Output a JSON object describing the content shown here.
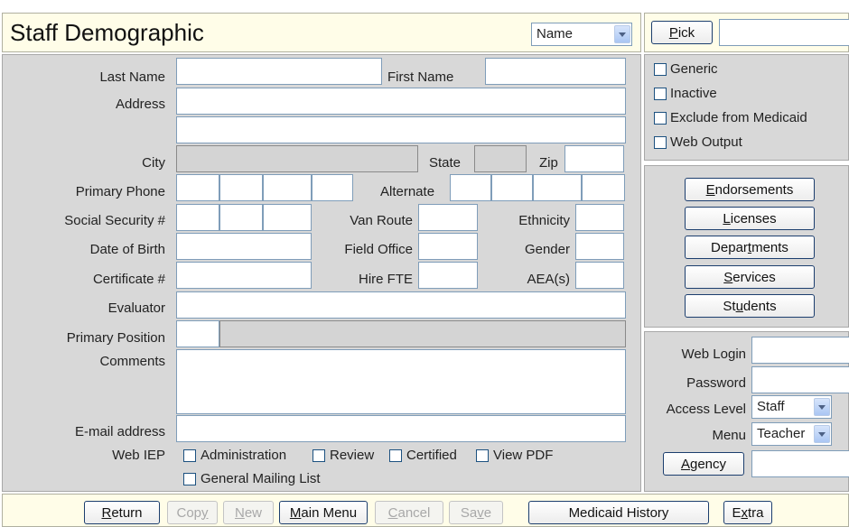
{
  "header": {
    "title": "Staff Demographic",
    "sort_select": "Name"
  },
  "pick": {
    "button_label": "Pick",
    "button_key": "P",
    "button_rest": "ick",
    "value": ""
  },
  "form": {
    "last_name_label": "Last Name",
    "first_name_label": "First Name",
    "address_label": "Address",
    "city_label": "City",
    "state_label": "State",
    "zip_label": "Zip",
    "primary_phone_label": "Primary Phone",
    "alternate_label": "Alternate",
    "ssn_label": "Social Security #",
    "van_route_label": "Van Route",
    "ethnicity_label": "Ethnicity",
    "dob_label": "Date of Birth",
    "field_office_label": "Field Office",
    "gender_label": "Gender",
    "certificate_label": "Certificate #",
    "hire_fte_label": "Hire FTE",
    "aea_label": "AEA(s)",
    "evaluator_label": "Evaluator",
    "primary_position_label": "Primary Position",
    "comments_label": "Comments",
    "email_label": "E-mail address",
    "web_iep_label": "Web IEP",
    "web_iep_options": [
      "Administration",
      "Review",
      "Certified",
      "View PDF"
    ],
    "general_mailing_label": "General Mailing List"
  },
  "flags": [
    "Generic",
    "Inactive",
    "Exclude from Medicaid",
    "Web Output"
  ],
  "side_buttons": [
    {
      "pre": "",
      "key": "E",
      "post": "ndorsements"
    },
    {
      "pre": "",
      "key": "L",
      "post": "icenses"
    },
    {
      "pre": "Depar",
      "key": "t",
      "post": "ments"
    },
    {
      "pre": "",
      "key": "S",
      "post": "ervices"
    },
    {
      "pre": "St",
      "key": "u",
      "post": "dents"
    }
  ],
  "web": {
    "login_label": "Web Login",
    "password_label": "Password",
    "access_level_label": "Access Level",
    "access_level_value": "Staff",
    "menu_label": "Menu",
    "menu_value": "Teacher",
    "agency_button": "Agency",
    "agency_key": "A",
    "agency_rest": "gency"
  },
  "footer": {
    "return_key": "R",
    "return_rest": "eturn",
    "copy_pre": "Cop",
    "copy_key": "y",
    "copy_post": "",
    "new_key": "N",
    "new_rest": "ew",
    "main_menu_key": "M",
    "main_menu_rest": "ain Menu",
    "cancel_key": "C",
    "cancel_rest": "ancel",
    "save_pre": "Sa",
    "save_key": "v",
    "save_post": "e",
    "medicaid_history": "Medicaid History",
    "extra_pre": "E",
    "extra_key": "x",
    "extra_post": "tra"
  },
  "colors": {
    "panel_gray": "#d8d8d8",
    "panel_yellow": "#fffde8",
    "button_border": "#1c3e6e",
    "field_border": "#7f9db9"
  }
}
